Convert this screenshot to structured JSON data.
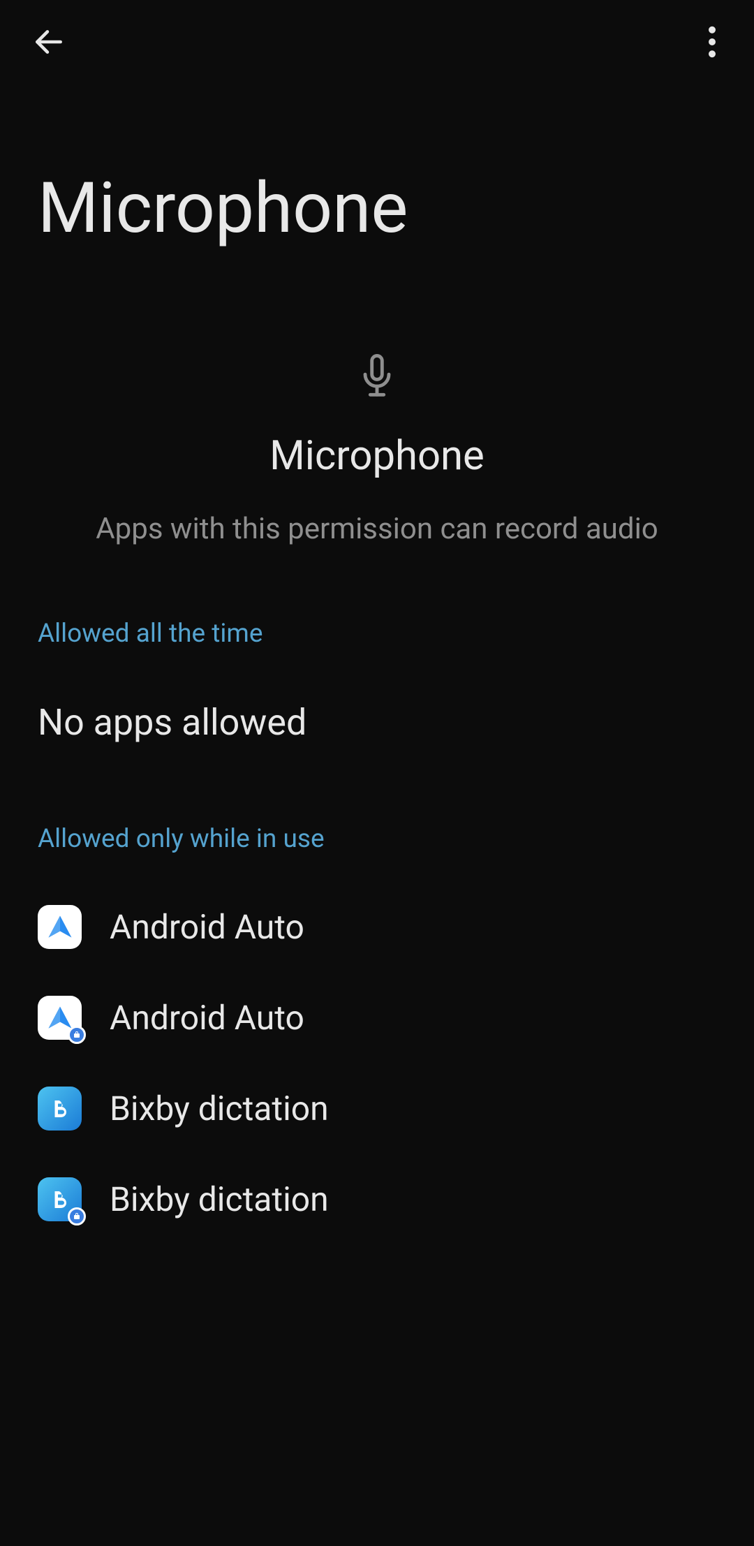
{
  "header": {
    "title": "Microphone"
  },
  "hero": {
    "label": "Microphone",
    "description": "Apps with this permission can record audio"
  },
  "sections": {
    "all_time": {
      "label": "Allowed all the time",
      "empty_text": "No apps allowed"
    },
    "while_in_use": {
      "label": "Allowed only while in use",
      "apps": [
        {
          "name": "Android Auto",
          "icon": "android-auto",
          "work_badge": false
        },
        {
          "name": "Android Auto",
          "icon": "android-auto",
          "work_badge": true
        },
        {
          "name": "Bixby dictation",
          "icon": "bixby",
          "work_badge": false
        },
        {
          "name": "Bixby dictation",
          "icon": "bixby",
          "work_badge": true
        }
      ]
    }
  }
}
